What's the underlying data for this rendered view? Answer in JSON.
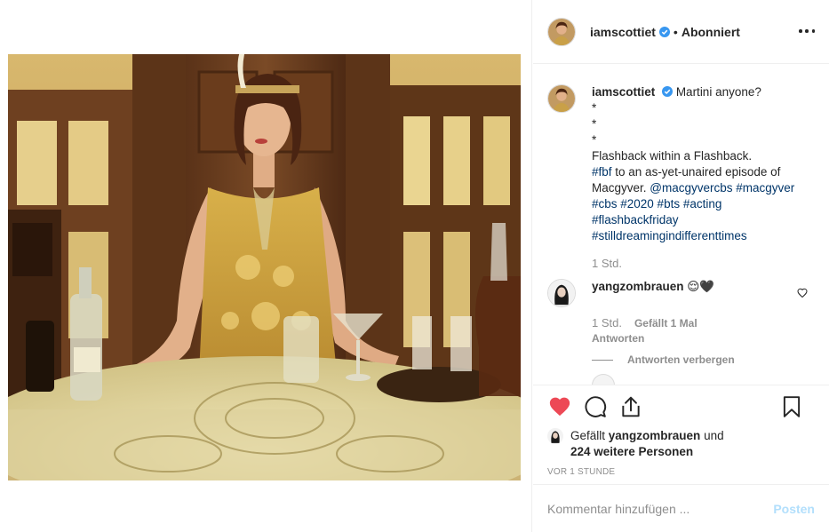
{
  "post": {
    "author": "iamscottiet",
    "follow_state": "Abonniert",
    "separator": "•"
  },
  "caption": {
    "username": "iamscottiet",
    "first_line": "Martini anyone?",
    "lines": [
      "*",
      "*",
      "*",
      "Flashback within a Flashback."
    ],
    "tag_fbf": "#fbf",
    "text_after_fbf": " to an as-yet-unaired episode of Macgyver. ",
    "mention": "@macgyvercbs",
    "tags_1": " #macgyver #cbs #2020 #bts #acting",
    "tags_2": "#flashbackfriday",
    "tags_3": "#stilldreamingindifferenttimes",
    "time": "1 Std."
  },
  "comment": {
    "username": "yangzombrauen",
    "text": "😌🖤",
    "time": "1 Std.",
    "likes": "Gefällt 1 Mal",
    "reply_label": "Antworten",
    "hide_replies_label": "Antworten verbergen"
  },
  "likes": {
    "prefix": "Gefällt ",
    "user": "yangzombrauen",
    "middle": " und",
    "count_text": "224 weitere Personen"
  },
  "timestamp": "VOR 1 STUNDE",
  "add_comment": {
    "placeholder": "Kommentar hinzufügen ...",
    "post_label": "Posten"
  },
  "colors": {
    "like_red": "#ed4956",
    "link_blue": "#003569",
    "verified_blue": "#3897f0",
    "post_disabled": "#b2dffc"
  }
}
